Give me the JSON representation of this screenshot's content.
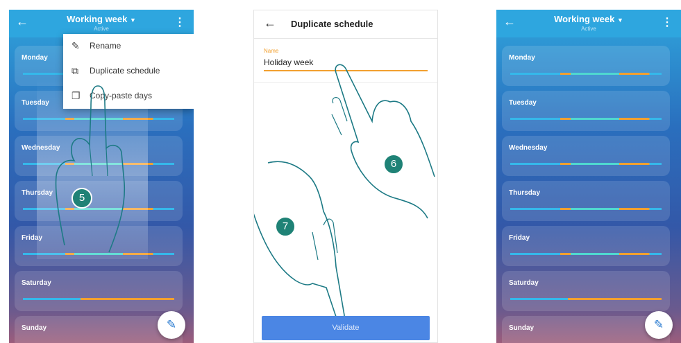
{
  "schedule": {
    "title": "Working week",
    "status": "Active"
  },
  "days": [
    "Monday",
    "Tuesday",
    "Wednesday",
    "Thursday",
    "Friday",
    "Saturday",
    "Sunday"
  ],
  "menu": {
    "rename": "Rename",
    "duplicate": "Duplicate schedule",
    "copy_paste": "Copy-paste days"
  },
  "duplicate_screen": {
    "title": "Duplicate schedule",
    "name_label": "Name",
    "name_value": "Holiday week",
    "validate_label": "Validate"
  },
  "steps": [
    "5",
    "6",
    "7"
  ],
  "colors": {
    "header": "#2ea6df",
    "comfort": "#4fd8d0",
    "eco": "#f2a02f",
    "base": "#35b8ea",
    "accent": "#f2a02f"
  },
  "icons": [
    "back-arrow-icon",
    "kebab-menu-icon",
    "pencil-icon",
    "duplicate-icon",
    "copy-icon",
    "dropdown-caret-icon"
  ]
}
